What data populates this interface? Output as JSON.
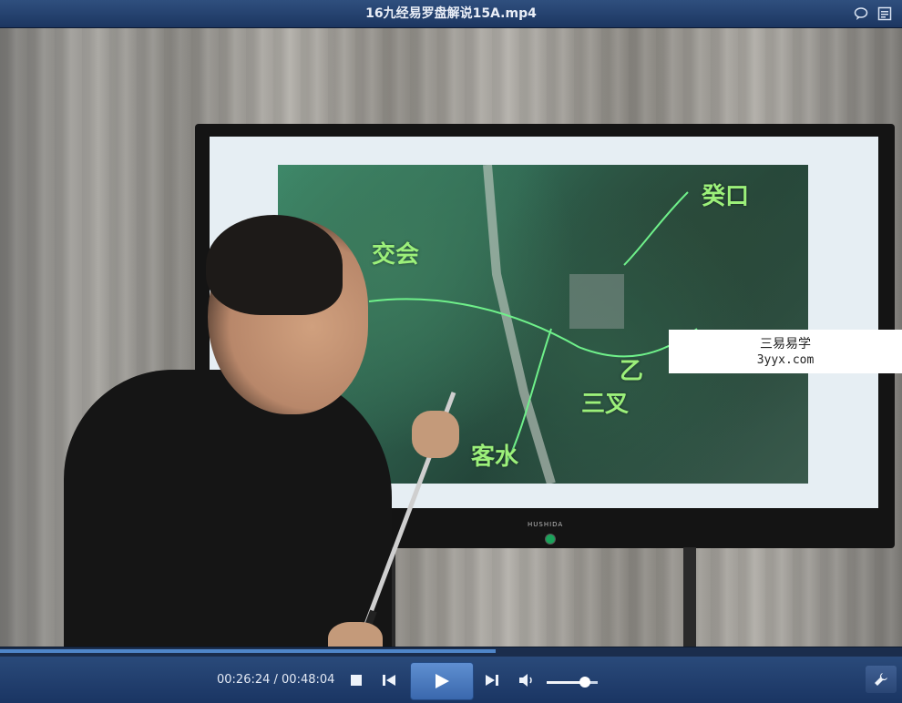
{
  "window": {
    "title": "16九经易罗盘解说15A.mp4"
  },
  "video": {
    "map_labels": [
      "交会",
      "癸口",
      "乙",
      "三叉",
      "客水"
    ],
    "tv_brand": "HUSHIDA",
    "watermark": {
      "line1": "三易易学",
      "line2": "3yyx.com"
    }
  },
  "playback": {
    "current_time": "00:26:24",
    "total_time": "00:48:04",
    "time_display": "00:26:24 / 00:48:04",
    "progress_fraction": 0.549,
    "volume_fraction": 0.75
  },
  "colors": {
    "titlebar": "#1c3661",
    "controlbar": "#1a3563",
    "play_button": "#4a7bc0",
    "progress": "#4f86c9",
    "map_label": "#9cf07a"
  },
  "icons": {
    "titlebar": [
      "chat-icon",
      "playlist-icon"
    ],
    "controls": [
      "stop-icon",
      "previous-icon",
      "play-icon",
      "next-icon",
      "volume-icon",
      "settings-icon"
    ]
  }
}
